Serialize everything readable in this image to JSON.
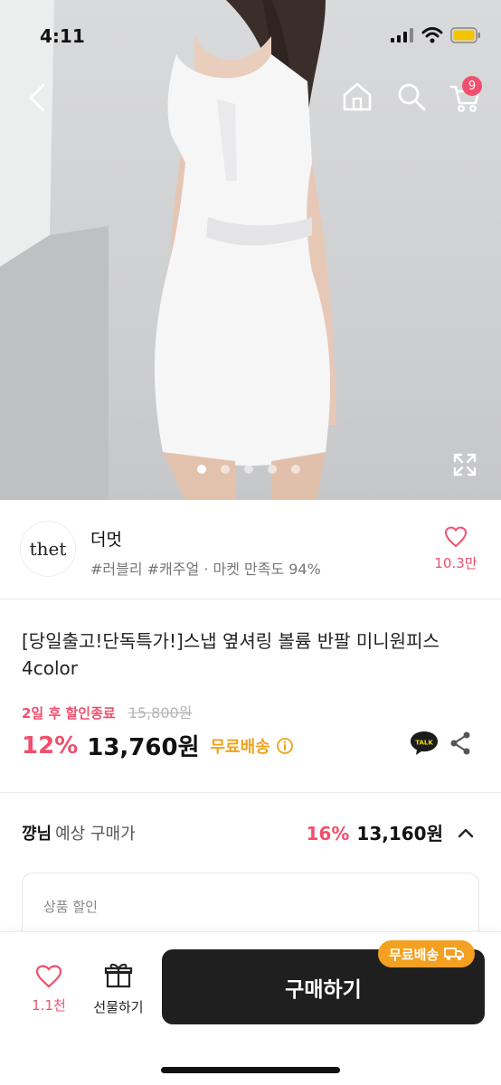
{
  "status_bar": {
    "time": "4:11"
  },
  "nav": {
    "cart_count": "9"
  },
  "gallery": {
    "dot_count": 5,
    "active_index": 0
  },
  "store": {
    "logo_text": "thet",
    "name": "더멋",
    "tags": "#러블리 #캐주얼 · 마켓 만족도 94%",
    "like_count": "10.3만"
  },
  "product": {
    "title": "[당일출고!단독특가!]스냅 옆셔링 볼륨 반팔 미니원피스 4color",
    "sale_timer": "2일 후 할인종료",
    "original_price": "15,800원",
    "discount": "12%",
    "price": "13,760원",
    "free_shipping": "무료배송"
  },
  "expected_price": {
    "nickname": "꺙님",
    "label": "예상 구매가",
    "discount": "16%",
    "price": "13,160원"
  },
  "discount_card": {
    "label": "상품 할인"
  },
  "bottom_bar": {
    "wish_count": "1.1천",
    "gift_label": "선물하기",
    "buy_label": "구매하기",
    "ship_badge": "무료배송"
  },
  "colors": {
    "accent": "#f0506e",
    "shipping": "#f1a31a",
    "button": "#1f1f1f"
  }
}
